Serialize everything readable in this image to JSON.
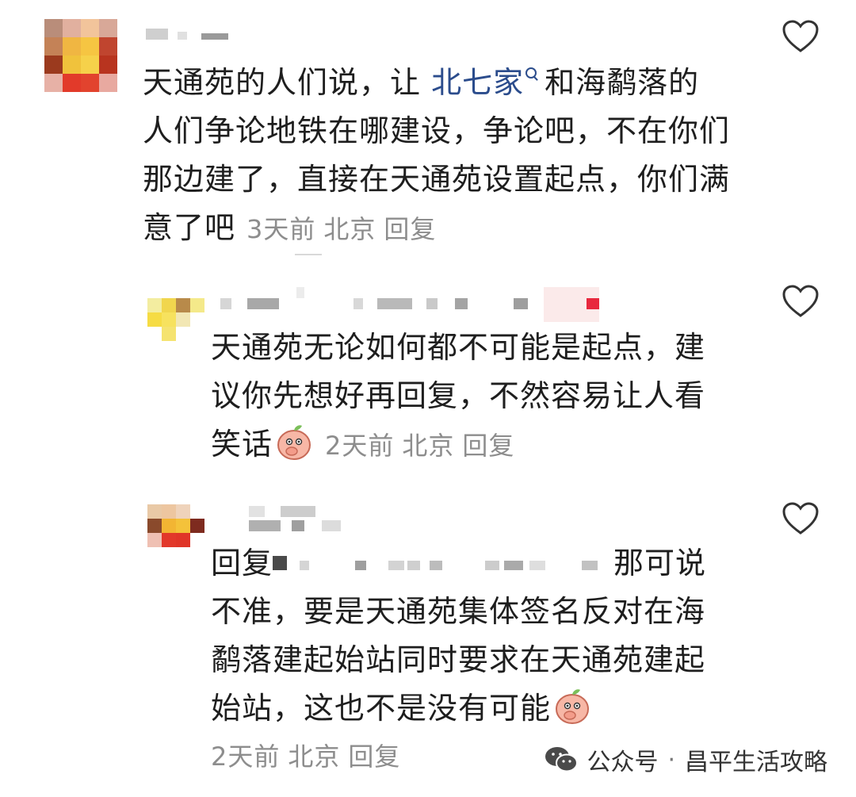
{
  "comments": [
    {
      "author": "",
      "text_parts": {
        "pre": "天通苑的人们说，让 ",
        "link": "北七家",
        "post_line1": "和海鹬落的",
        "line2": "人们争论地铁在哪建设，争论吧，不在你们",
        "line3": "那边建了，直接在天通苑设置起点，你们满",
        "line4": "意了吧"
      },
      "time": "3天前",
      "location": "北京",
      "reply_label": "回复"
    },
    {
      "author": "",
      "line1": "天通苑无论如何都不可能是起点，建",
      "line2": "议你先想好再回复，不然容易让人看",
      "line3": "笑话",
      "time": "2天前",
      "location": "北京",
      "reply_label": "回复"
    },
    {
      "author": "",
      "reply_prefix": "回复",
      "line1_end": "那可说",
      "line2": "不准，要是天通苑集体签名反对在海",
      "line3": "鹬落建起始站同时要求在天通苑建起",
      "line4": "始站，这也不是没有可能",
      "time": "2天前",
      "location": "北京",
      "reply_label": "回复"
    }
  ],
  "footer": {
    "platform": "公众号",
    "separator": "·",
    "account": "昌平生活攻略"
  },
  "icons": {
    "like": "heart-outline-icon",
    "emoji": "peach-face-emoji-icon",
    "wechat": "wechat-icon"
  },
  "colors": {
    "text": "#1e1e1e",
    "meta": "#8d8d8d",
    "link": "#2b4c8c",
    "heart": "#333333"
  }
}
